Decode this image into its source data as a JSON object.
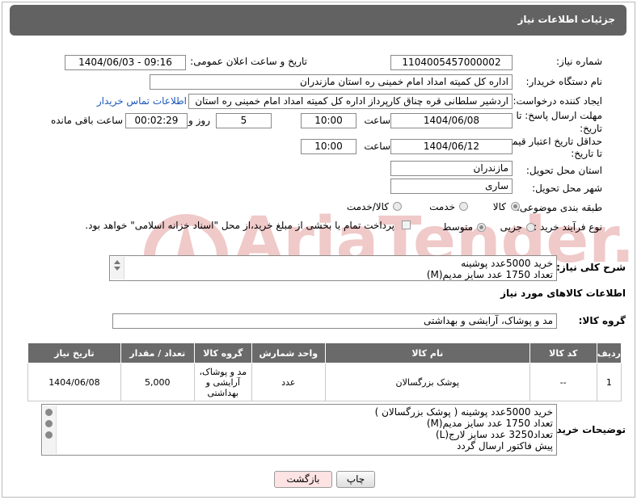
{
  "page": {
    "title": "جزئیات اطلاعات نیاز"
  },
  "fields": {
    "need_number_label": "شماره نیاز:",
    "need_number": "1104005457000002",
    "announce_label": "تاریخ و ساعت اعلان عمومی:",
    "announce_value": "1404/06/03 - 09:16",
    "buyer_org_label": "نام دستگاه خریدار:",
    "buyer_org": "اداره کل کمیته امداد امام خمینی  ره  استان مازندران",
    "requester_label": "ایجاد کننده درخواست:",
    "requester": "اردشیر سلطانی قره چناق کارپرداز اداره کل کمیته امداد امام خمینی  ره  استان",
    "contact_link": "اطلاعات تماس خریدار",
    "deadline_label_1": "مهلت ارسال پاسخ: تا",
    "deadline_label_2": "تاریخ:",
    "deadline_date": "1404/06/08",
    "time_label": "ساعت",
    "deadline_time": "10:00",
    "days_value": "5",
    "days_label": "روز و",
    "remaining_time": "00:02:29",
    "remaining_label": "ساعت باقی مانده",
    "price_label_1": "حداقل تاریخ اعتبار قیمت:",
    "price_label_2": "تا تاریخ:",
    "price_date": "1404/06/12",
    "price_time": "10:00",
    "province_label": "استان محل تحویل:",
    "province": "مازندران",
    "city_label": "شهر محل تحویل:",
    "city": "ساری",
    "category_label": "طبقه بندی موضوعی:",
    "category_options": [
      "کالا",
      "خدمت",
      "کالا/خدمت"
    ],
    "process_label": "نوع فرآیند خرید :",
    "process_options": [
      "جزیی",
      "متوسط"
    ],
    "payment_note": "پرداخت تمام یا بخشی از مبلغ خرید،از محل \"اسناد خزانه اسلامی\" خواهد بود."
  },
  "summary": {
    "label": "شرح کلی نیاز:",
    "lines": [
      "خرید 5000عدد پوشینه",
      "تعداد 1750 عدد سایز مدیم(M)"
    ]
  },
  "goods_section": {
    "title": "اطلاعات کالاهای مورد نیاز"
  },
  "group": {
    "label": "گروه کالا:",
    "value": "مد و پوشاک، آرایشی و بهداشتی"
  },
  "table": {
    "headers": [
      "ردیف",
      "کد کالا",
      "نام کالا",
      "واحد شمارش",
      "گروه کالا",
      "تعداد / مقدار",
      "تاریخ نیاز"
    ],
    "rows": [
      [
        "1",
        "--",
        "پوشک بزرگسالان",
        "عدد",
        "مد و پوشاک، آرایشی و بهداشتی",
        "5,000",
        "1404/06/08"
      ]
    ]
  },
  "buyer_notes": {
    "label": "توضیحات خریدار:",
    "lines": [
      "خرید 5000عدد پوشینه ( پوشک بزرگسالان )",
      "تعداد 1750 عدد سایز مدیم(M)",
      "تعداد3250 عدد سایز لارج(L)",
      "پیش فاکتور ارسال گردد"
    ]
  },
  "buttons": {
    "print": "چاپ",
    "back": "بازگشت"
  },
  "watermark": {
    "text": "AriaTender.net"
  },
  "colors": {
    "header_bg": "#626262",
    "link": "#1a58b8",
    "back_button_bg": "#fde3e3",
    "watermark": "#f0c9c9"
  }
}
